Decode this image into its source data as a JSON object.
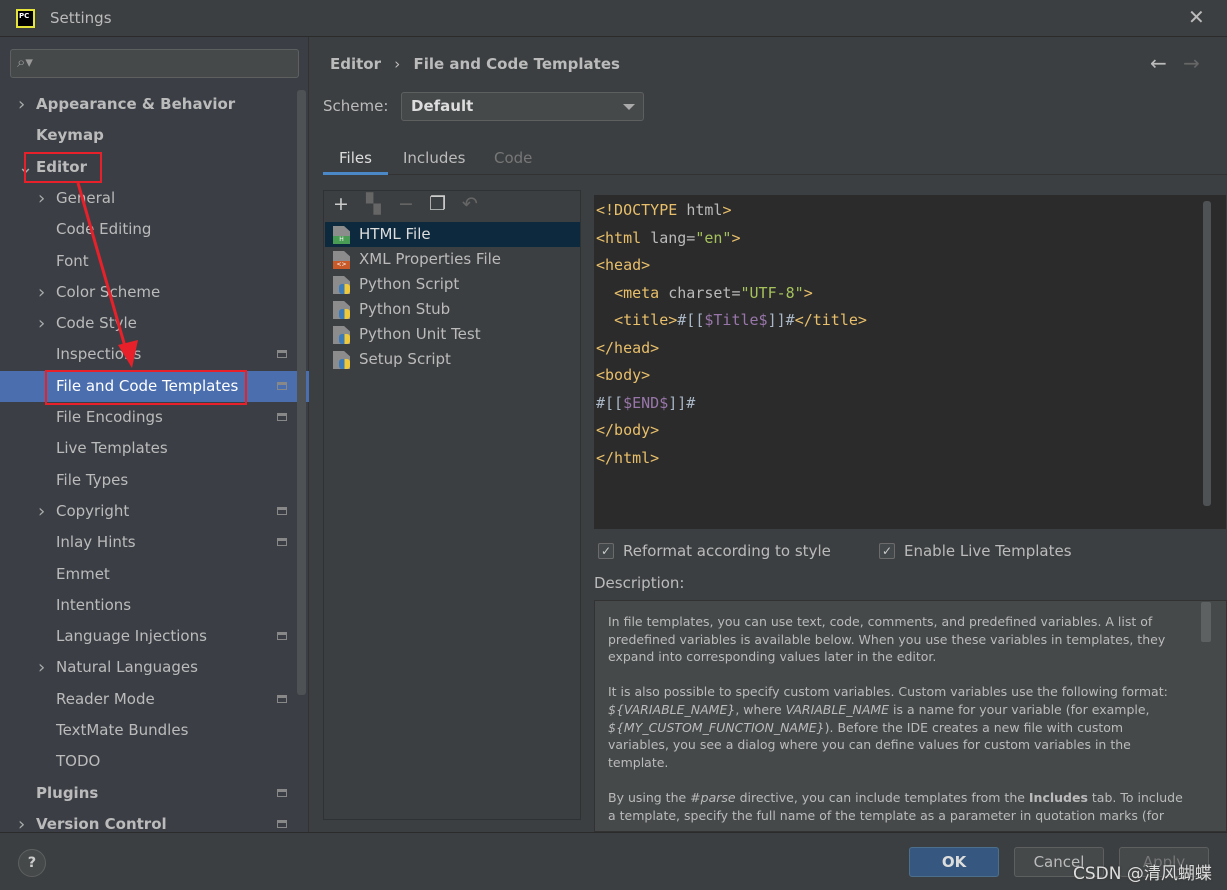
{
  "window": {
    "title": "Settings",
    "logo_text": "PC",
    "close_icon": "close-icon"
  },
  "sidebar": {
    "search_placeholder": "",
    "items": [
      {
        "label": "Appearance & Behavior",
        "level": 0,
        "bold": true,
        "chevron": "right"
      },
      {
        "label": "Keymap",
        "level": 0,
        "bold": true
      },
      {
        "label": "Editor",
        "level": 0,
        "bold": true,
        "chevron": "down"
      },
      {
        "label": "General",
        "level": 1,
        "chevron": "right"
      },
      {
        "label": "Code Editing",
        "level": 1
      },
      {
        "label": "Font",
        "level": 1
      },
      {
        "label": "Color Scheme",
        "level": 1,
        "chevron": "right"
      },
      {
        "label": "Code Style",
        "level": 1,
        "chevron": "right"
      },
      {
        "label": "Inspections",
        "level": 1,
        "project": true
      },
      {
        "label": "File and Code Templates",
        "level": 1,
        "selected": true,
        "project": true
      },
      {
        "label": "File Encodings",
        "level": 1,
        "project": true
      },
      {
        "label": "Live Templates",
        "level": 1
      },
      {
        "label": "File Types",
        "level": 1
      },
      {
        "label": "Copyright",
        "level": 1,
        "chevron": "right",
        "project": true
      },
      {
        "label": "Inlay Hints",
        "level": 1,
        "project": true
      },
      {
        "label": "Emmet",
        "level": 1
      },
      {
        "label": "Intentions",
        "level": 1
      },
      {
        "label": "Language Injections",
        "level": 1,
        "project": true
      },
      {
        "label": "Natural Languages",
        "level": 1,
        "chevron": "right"
      },
      {
        "label": "Reader Mode",
        "level": 1,
        "project": true
      },
      {
        "label": "TextMate Bundles",
        "level": 1
      },
      {
        "label": "TODO",
        "level": 1
      },
      {
        "label": "Plugins",
        "level": 0,
        "bold": true,
        "project": true
      },
      {
        "label": "Version Control",
        "level": 0,
        "bold": true,
        "chevron": "right",
        "project": true
      }
    ]
  },
  "breadcrumb": {
    "parent": "Editor",
    "separator": "›",
    "current": "File and Code Templates"
  },
  "nav": {
    "back": "←",
    "forward": "→"
  },
  "scheme": {
    "label": "Scheme:",
    "value": "Default"
  },
  "tabs": [
    {
      "label": "Files",
      "active": true
    },
    {
      "label": "Includes"
    },
    {
      "label": "Code",
      "disabled": true
    }
  ],
  "toolbar": [
    {
      "icon": "plus-icon",
      "glyph": "+"
    },
    {
      "icon": "add-child-icon",
      "glyph": "▚",
      "disabled": true
    },
    {
      "icon": "minus-icon",
      "glyph": "−",
      "disabled": true
    },
    {
      "icon": "copy-icon",
      "glyph": "❐"
    },
    {
      "icon": "reset-icon",
      "glyph": "↶",
      "disabled": true
    }
  ],
  "templates": [
    {
      "label": "HTML File",
      "icon": "html-file-icon",
      "badge": "H",
      "badge_color": "#499c54",
      "selected": true
    },
    {
      "label": "XML Properties File",
      "icon": "xml-file-icon",
      "badge": "<>",
      "badge_color": "#c75a28"
    },
    {
      "label": "Python Script",
      "icon": "python-file-icon"
    },
    {
      "label": "Python Stub",
      "icon": "python-file-icon"
    },
    {
      "label": "Python Unit Test",
      "icon": "python-file-icon"
    },
    {
      "label": "Setup Script",
      "icon": "python-file-icon"
    }
  ],
  "code": [
    [
      [
        "tag",
        "<!DOCTYPE "
      ],
      [
        "attr",
        "html"
      ],
      [
        "tag",
        ">"
      ]
    ],
    [
      [
        "tag",
        "<html "
      ],
      [
        "attr",
        "lang="
      ],
      [
        "val",
        "\"en\""
      ],
      [
        "tag",
        ">"
      ]
    ],
    [
      [
        "tag",
        "<head>"
      ]
    ],
    [
      [
        "txt",
        "  "
      ],
      [
        "tag",
        "<meta "
      ],
      [
        "attr",
        "charset="
      ],
      [
        "val",
        "\"UTF-8\""
      ],
      [
        "tag",
        ">"
      ]
    ],
    [
      [
        "txt",
        "  "
      ],
      [
        "tag",
        "<title>"
      ],
      [
        "txt",
        "#[["
      ],
      [
        "var",
        "$Title$"
      ],
      [
        "txt",
        "]]#"
      ],
      [
        "tag",
        "</title>"
      ]
    ],
    [
      [
        "tag",
        "</head>"
      ]
    ],
    [
      [
        "tag",
        "<body>"
      ]
    ],
    [
      [
        "txt",
        "#[["
      ],
      [
        "var",
        "$END$"
      ],
      [
        "txt",
        "]]#"
      ]
    ],
    [
      [
        "tag",
        "</body>"
      ]
    ],
    [
      [
        "tag",
        "</html>"
      ]
    ]
  ],
  "options": {
    "reformat": {
      "label": "Reformat according to style",
      "checked": true
    },
    "live_templates": {
      "label": "Enable Live Templates",
      "checked": true
    }
  },
  "description": {
    "label": "Description:",
    "p1": "In file templates, you can use text, code, comments, and predefined variables. A list of predefined variables is available below. When you use these variables in templates, they expand into corresponding values later in the editor.",
    "p2a": "It is also possible to specify custom variables. Custom variables use the following format: ",
    "p2b": "${VARIABLE_NAME}",
    "p2c": ", where ",
    "p2d": "VARIABLE_NAME",
    "p2e": " is a name for your variable (for example, ",
    "p2f": "${MY_CUSTOM_FUNCTION_NAME}",
    "p2g": "). Before the IDE creates a new file with custom variables, you see a dialog where you can define values for custom variables in the template.",
    "p3a": "By using the ",
    "p3b": "#parse",
    "p3c": " directive, you can include templates from the ",
    "p3d": "Includes",
    "p3e": " tab. To include a template, specify the full name of the template as a parameter in quotation marks (for"
  },
  "buttons": {
    "help": "?",
    "ok": "OK",
    "cancel": "Cancel",
    "apply": "Apply"
  },
  "watermark": "CSDN @清风蝴蝶",
  "colors": {
    "selection": "#4b6eaf",
    "annotation": "#e8202a",
    "ok_button": "#365880"
  }
}
